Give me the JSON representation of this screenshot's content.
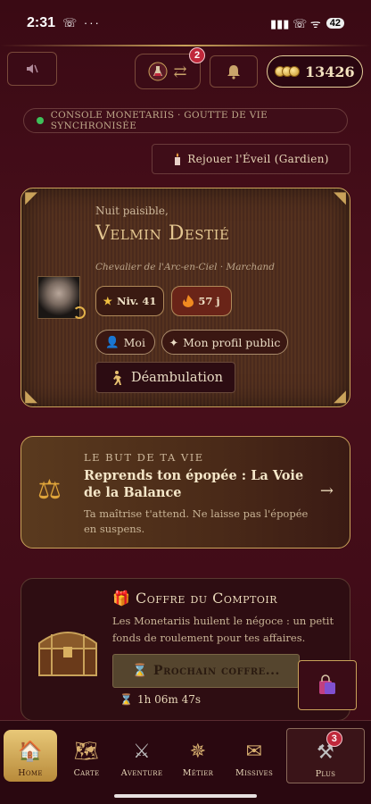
{
  "status_bar": {
    "time": "2:31",
    "left_icons": "☏ ···",
    "right_icons": "▮▮▮ ☏ ᯤ",
    "battery": "42"
  },
  "topbar": {
    "notification_badge": "2",
    "coins": "13426"
  },
  "console": {
    "label": "Console Monetariis · Goutte de vie synchronisée",
    "status_color": "#3fbf5a"
  },
  "replay": {
    "label": "Rejouer l'Éveil (Gardien)"
  },
  "profile": {
    "greeting": "Nuit paisible,",
    "name": "Velmin Destié",
    "title": "Chevalier de l'Arc-en-Ciel · Marchand",
    "level": "Niv. 41",
    "streak": "57 j",
    "me_label": "Moi",
    "public_profile_label": "Mon profil public",
    "wander_label": "Déambulation"
  },
  "purpose": {
    "kicker": "Le but de ta vie",
    "title": "Reprends ton épopée : La Voie de la Balance",
    "description": "Ta maîtrise t'attend. Ne laisse pas l'épopée en suspens.",
    "arrow": "→"
  },
  "chest": {
    "title": "Coffre du Comptoir",
    "description": "Les Monetariis huilent le négoce : un petit fonds de roulement pour tes affaires.",
    "next_label": "Prochain coffre...",
    "timer": "1h 06m 47s"
  },
  "bottom_nav": {
    "items": [
      {
        "label": "Home",
        "icon": "house-icon"
      },
      {
        "label": "Carte",
        "icon": "map-icon"
      },
      {
        "label": "Aventure",
        "icon": "swords-icon"
      },
      {
        "label": "Métier",
        "icon": "compass-icon"
      },
      {
        "label": "Missives",
        "icon": "envelope-icon"
      },
      {
        "label": "Plus",
        "icon": "tools-icon"
      }
    ],
    "more_badge": "3"
  },
  "colors": {
    "background": "#3a0a14",
    "gold_accent": "#c9a25a",
    "badge_red": "#c0283b"
  }
}
